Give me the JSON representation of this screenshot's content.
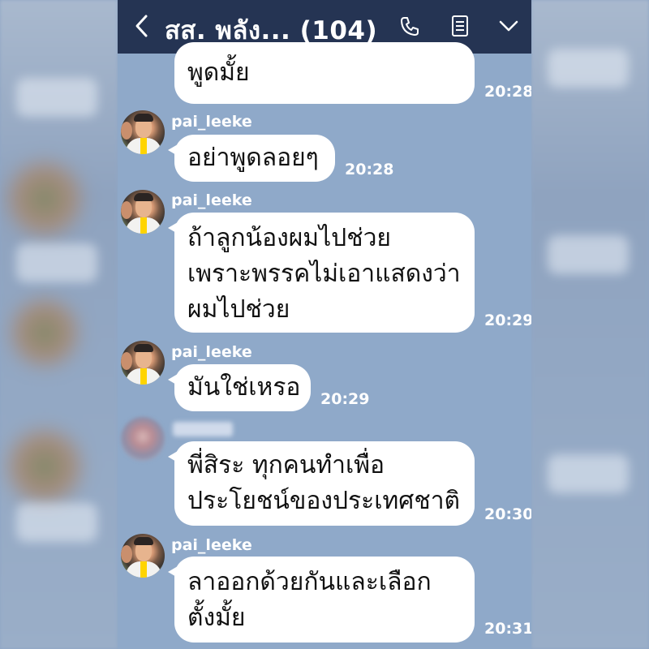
{
  "header": {
    "title": "สส. พลัง... (104)",
    "back_icon": "chevron-left-icon",
    "call_icon": "phone-icon",
    "note_icon": "note-icon",
    "menu_icon": "chevron-down-icon"
  },
  "messages": [
    {
      "sender": "",
      "text_lines": [
        "พูดมั้ย"
      ],
      "time": "20:28"
    },
    {
      "sender": "pai_leeke",
      "text_lines": [
        "อย่าพูดลอยๆ"
      ],
      "time": "20:28"
    },
    {
      "sender": "pai_leeke",
      "text_lines": [
        "ถ้าลูกน้องผมไปช่วย",
        "เพราะพรรคไม่เอาแสดงว่า",
        "ผมไปช่วย"
      ],
      "time": "20:29"
    },
    {
      "sender": "pai_leeke",
      "text_lines": [
        "มันใช่เหรอ"
      ],
      "time": "20:29"
    },
    {
      "sender": "",
      "text_lines": [
        "พี่สิระ ทุกคนทำเพื่อ",
        "ประโยชน์ของประเทศชาติ"
      ],
      "time": "20:30"
    },
    {
      "sender": "pai_leeke",
      "text_lines": [
        "ลาออกด้วยกันและเลือก",
        "ตั้งมั้ย"
      ],
      "time": "20:31"
    }
  ],
  "colors": {
    "header_bg": "#253453",
    "chat_bg": "#8fa9c9",
    "bubble_bg": "#ffffff",
    "text_light": "#ffffff"
  }
}
